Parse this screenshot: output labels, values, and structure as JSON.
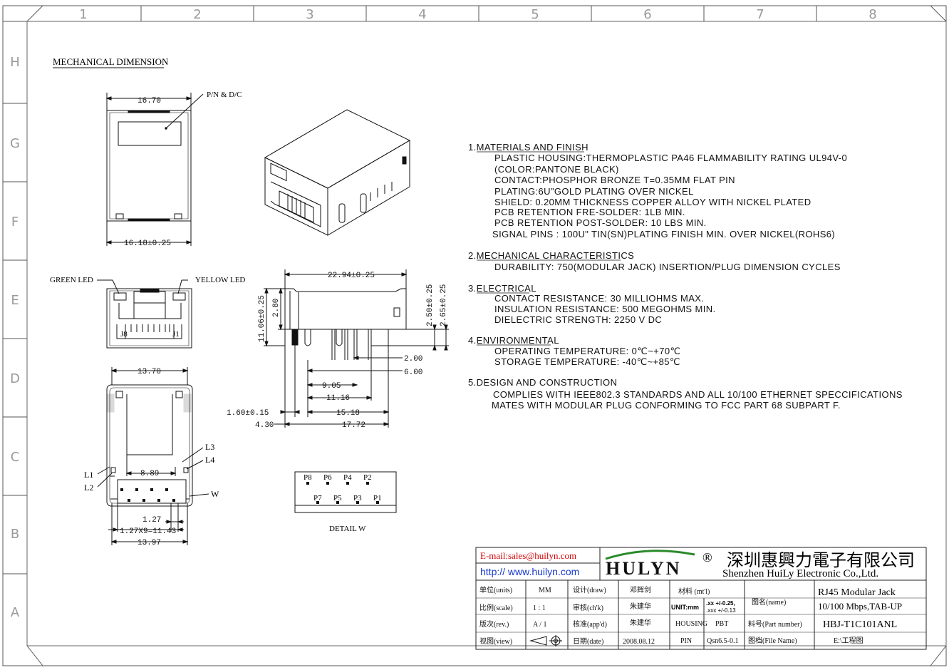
{
  "grid": {
    "columns": [
      "1",
      "2",
      "3",
      "4",
      "5",
      "6",
      "7",
      "8"
    ],
    "rows": [
      "H",
      "G",
      "F",
      "E",
      "D",
      "C",
      "B",
      "A"
    ]
  },
  "heading": "MECHANICAL DIMENSION",
  "top_view": {
    "width_top": "16.70",
    "width_bottom": "16.18±0.25",
    "pn_label": "P/N & D/C"
  },
  "front_view": {
    "green_led": "GREEN LED",
    "yellow_led": "YELLOW LED",
    "pin_left": "J8",
    "pin_right": "J1"
  },
  "side_view": {
    "length": "22.94±0.25",
    "height": "11.06±0.25",
    "h2": "2.80",
    "h3": "2.50±0.25",
    "h4": "2.65±0.25",
    "d1": "2.00",
    "d2": "6.00",
    "d3": "9.05",
    "d4": "11.16",
    "d5": "1.60±0.15",
    "d6": "15.18",
    "d7": "4.30",
    "d8": "17.72"
  },
  "bottom_view": {
    "width": "13.70",
    "pitch_span": "8.89",
    "pitch": "1.27",
    "row_span": "1.27X9=11.43",
    "total": "13.97",
    "L1": "L1",
    "L2": "L2",
    "L3": "L3",
    "L4": "L4",
    "W": "W"
  },
  "detail": {
    "top_pins": [
      "P8",
      "P6",
      "P4",
      "P2"
    ],
    "bottom_pins": [
      "P7",
      "P5",
      "P3",
      "P1"
    ],
    "label": "DETAIL W"
  },
  "notes": [
    {
      "head": "1.MATERIALS AND FINISH",
      "lines": [
        "PLASTIC HOUSING:THERMOPLASTIC PA46 FLAMMABILITY RATING UL94V-0",
        "(COLOR:PANTONE BLACK)",
        "CONTACT:PHOSPHOR BRONZE T=0.35MM FLAT PIN",
        "PLATING:6U\"GOLD PLATING OVER NICKEL",
        "SHIELD: 0.20MM THICKNESS COPPER ALLOY WITH NICKEL PLATED",
        "PCB RETENTION FRE-SOLDER:  1LB MIN.",
        "PCB RETENTION POST-SOLDER: 10 LBS MIN.",
        "SIGNAL PINS : 100U\"  TIN(SN)PLATING FINISH MIN. OVER NICKEL(ROHS6)"
      ]
    },
    {
      "head": "2.MECHANICAL CHARACTERISTICS",
      "lines": [
        "DURABILITY: 750(MODULAR JACK) INSERTION/PLUG DIMENSION CYCLES"
      ]
    },
    {
      "head": "3.ELECTRICAL",
      "lines": [
        "CONTACT RESISTANCE:      30 MILLIOHMS MAX.",
        "INSULATION RESISTANCE:    500 MEGOHMS MIN.",
        "DIELECTRIC STRENGTH:      2250 V DC"
      ]
    },
    {
      "head": "4.ENVIRONMENTAL",
      "lines": [
        "OPERATING TEMPERATURE:     0℃~+70℃",
        "STORAGE TEMPERATURE:    -40℃~+85℃"
      ]
    },
    {
      "head": "5.DESIGN AND CONSTRUCTION",
      "lines": [
        "COMPLIES WITH IEEE802.3 STANDARDS AND ALL 10/100 ETHERNET SPECCIFICATIONS",
        "MATES WITH MODULAR PLUG CONFORMING TO FCC PART 68 SUBPART F."
      ]
    }
  ],
  "title_block": {
    "email": "E-mail:sales@huilyn.com",
    "web": "http:// www.huilyn.com",
    "logo": "HULYN",
    "registered": "®",
    "company_cn": "深圳惠興力電子有限公司",
    "company_en": "Shenzhen HuiLy Electronic Co.,Ltd.",
    "units_label": "单位(units)",
    "units": "MM",
    "scale_label": "比例(scale)",
    "scale": "1 : 1",
    "rev_label": "版次(rev.)",
    "rev": "A / 1",
    "view_label": "视图(view)",
    "draw_label": "设计(draw)",
    "draw": "邓辉剑",
    "chk_label": "审核(ch'k)",
    "chk": "朱建华",
    "appd_label": "核准(app'd)",
    "appd": "朱建华",
    "date_label": "日期(date)",
    "date": "2008.08.12",
    "mt_label": "材料 (mt'l)",
    "unit_mm": "UNIT:mm",
    "tol1": ".xx  +/-0.25,",
    "tol2": ".xxx +/-0.13",
    "housing": "HOUSING",
    "pbt": "PBT",
    "pin": "PIN",
    "pin_mat": "Qsn6.5-0.1",
    "name_label": "图名(name)",
    "name1": "RJ45 Modular Jack",
    "name2": "10/100 Mbps,TAB-UP",
    "part_label": "料号(Part number)",
    "part": "HBJ-T1C101ANL",
    "file_label": "图档(File Name)",
    "file": "E:\\工程图",
    "colors": {
      "email": "#d00000",
      "web": "#1a3ad0",
      "logo": "#111111",
      "swoosh": "#2a8a2a"
    }
  }
}
